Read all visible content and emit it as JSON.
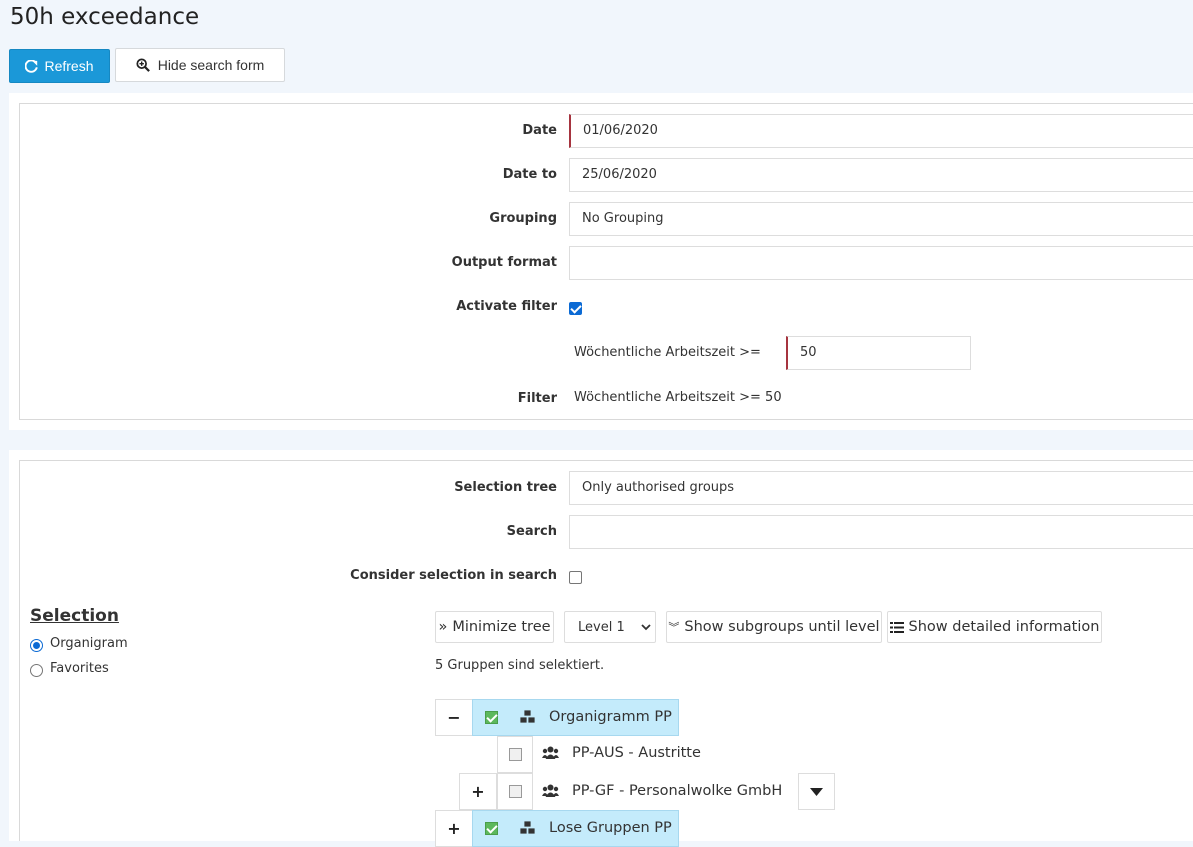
{
  "page": {
    "title": "50h exceedance"
  },
  "toolbar": {
    "refresh_label": "Refresh",
    "hide_search_label": "Hide search form"
  },
  "form": {
    "date_label": "Date",
    "date_value": "01/06/2020",
    "date_to_label": "Date to",
    "date_to_value": "25/06/2020",
    "grouping_label": "Grouping",
    "grouping_value": "No Grouping",
    "output_format_label": "Output format",
    "output_format_value": "",
    "activate_filter_label": "Activate filter",
    "activate_filter_checked": true,
    "filter_field_label": "Wöchentliche Arbeitszeit >=",
    "filter_field_value": "50",
    "filter_label": "Filter",
    "filter_value": "Wöchentliche Arbeitszeit >= 50"
  },
  "selection_form": {
    "selection_tree_label": "Selection tree",
    "selection_tree_value": "Only authorised groups",
    "search_label": "Search",
    "search_value": "",
    "consider_label": "Consider selection in search",
    "consider_checked": false
  },
  "selection": {
    "heading": "Selection",
    "options": [
      {
        "label": "Organigram",
        "selected": true
      },
      {
        "label": "Favorites",
        "selected": false
      }
    ]
  },
  "tree_toolbar": {
    "minimize_label": "Minimize tree",
    "level_value": "Level 1",
    "subgroups_label": "Show subgroups until level",
    "detailed_label": "Show detailed information"
  },
  "tree": {
    "status": "5 Gruppen sind selektiert.",
    "nodes": [
      {
        "label": "Organigramm PP",
        "expander": "−",
        "checked": true,
        "icon": "cubes-icon"
      },
      {
        "label": "PP-AUS - Austritte",
        "expander": "",
        "checked": false,
        "icon": "users-icon"
      },
      {
        "label": "PP-GF - Personalwolke GmbH",
        "expander": "+",
        "checked": false,
        "icon": "users-icon"
      },
      {
        "label": "Lose Gruppen PP",
        "expander": "+",
        "checked": true,
        "icon": "cubes-icon"
      }
    ]
  },
  "colors": {
    "primary": "#1b98d8",
    "highlight": "#c4ebfb",
    "required": "#a6343f",
    "check_green": "#5cb85c"
  }
}
